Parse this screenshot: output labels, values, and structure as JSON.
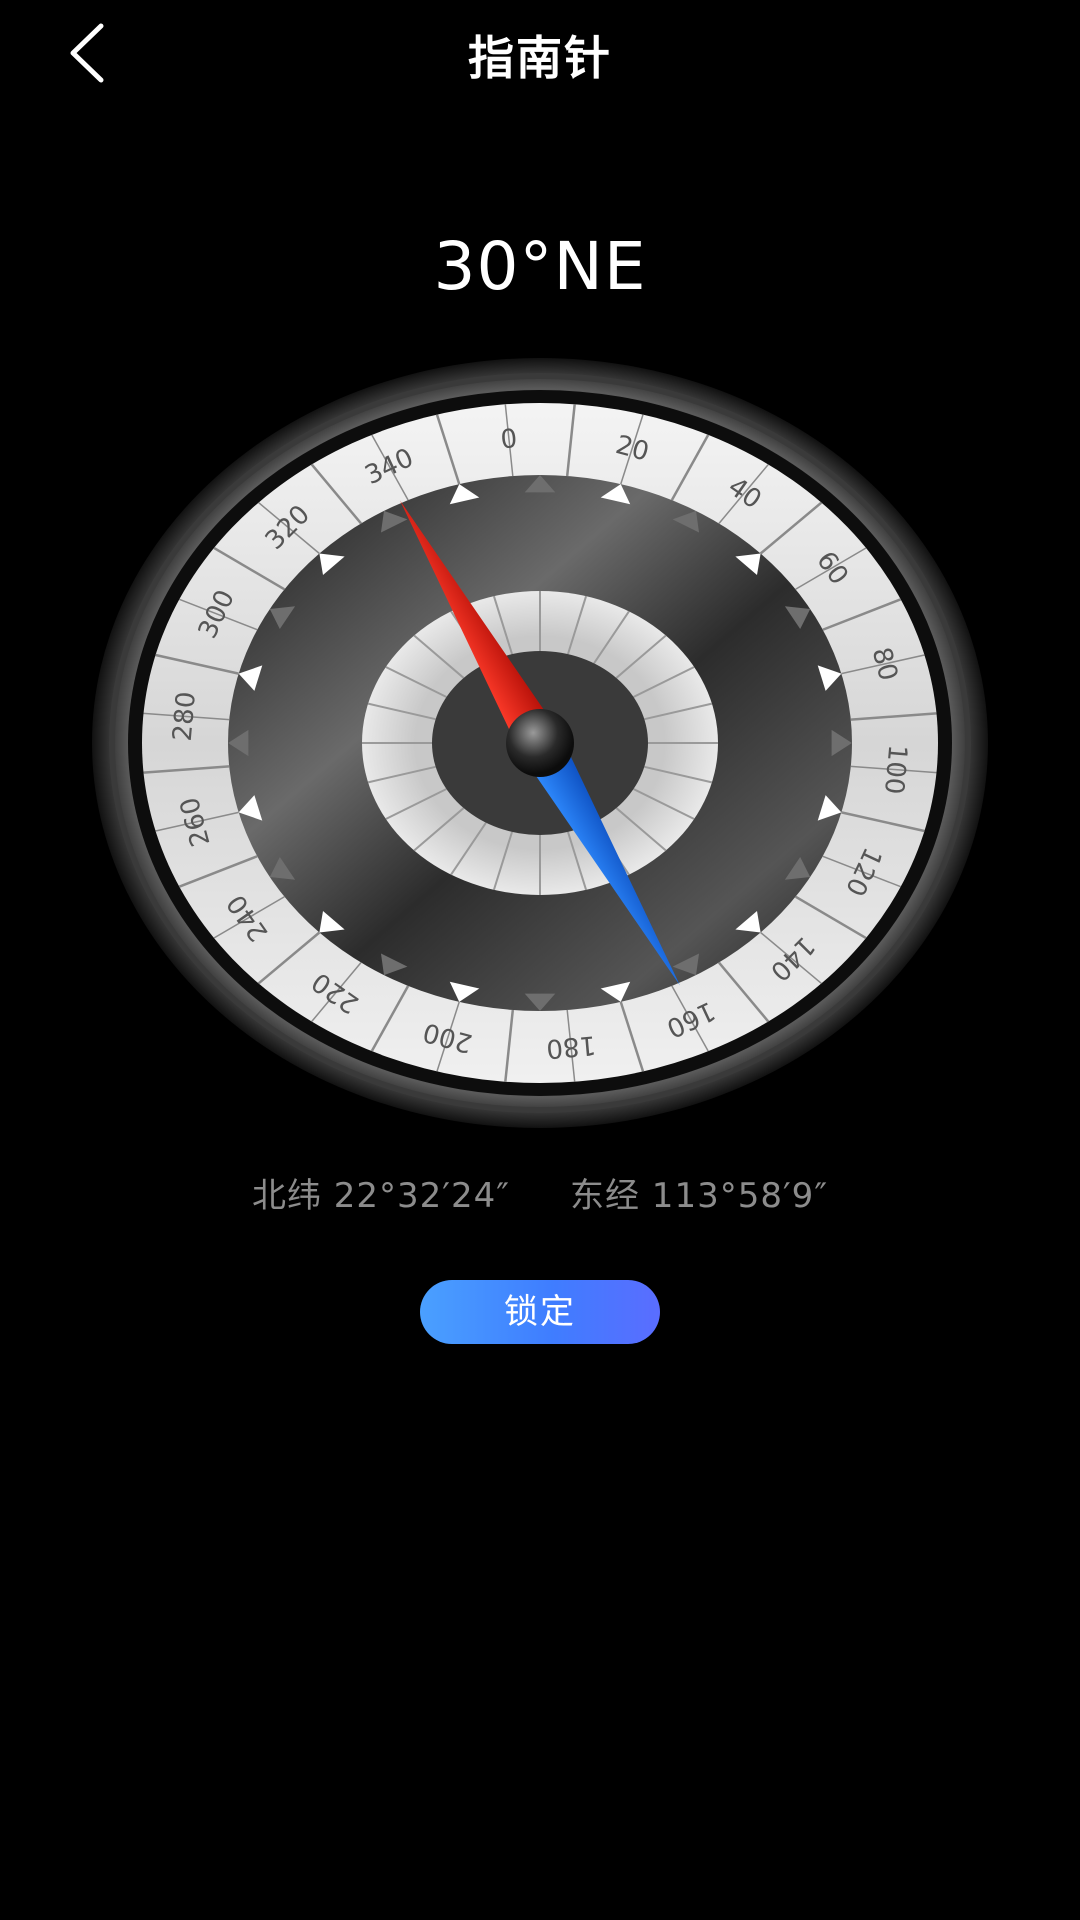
{
  "header": {
    "title": "指南针",
    "back_icon": "chevron-left-icon"
  },
  "heading": {
    "text": "30°NE",
    "degrees": 30
  },
  "dial": {
    "labels": [
      "0",
      "20",
      "40",
      "60",
      "80",
      "100",
      "120",
      "140",
      "160",
      "180",
      "200",
      "220",
      "240",
      "260",
      "280",
      "300",
      "320",
      "340"
    ]
  },
  "coordinates": {
    "latitude": "北纬 22°32′24″",
    "longitude": "东经 113°58′9″"
  },
  "lock_button": {
    "label": "锁定"
  },
  "colors": {
    "background": "#000000",
    "needle_north": "#e0251b",
    "needle_south": "#1e6fe6",
    "button_start": "#4aa0ff",
    "button_end": "#5a6dff"
  }
}
